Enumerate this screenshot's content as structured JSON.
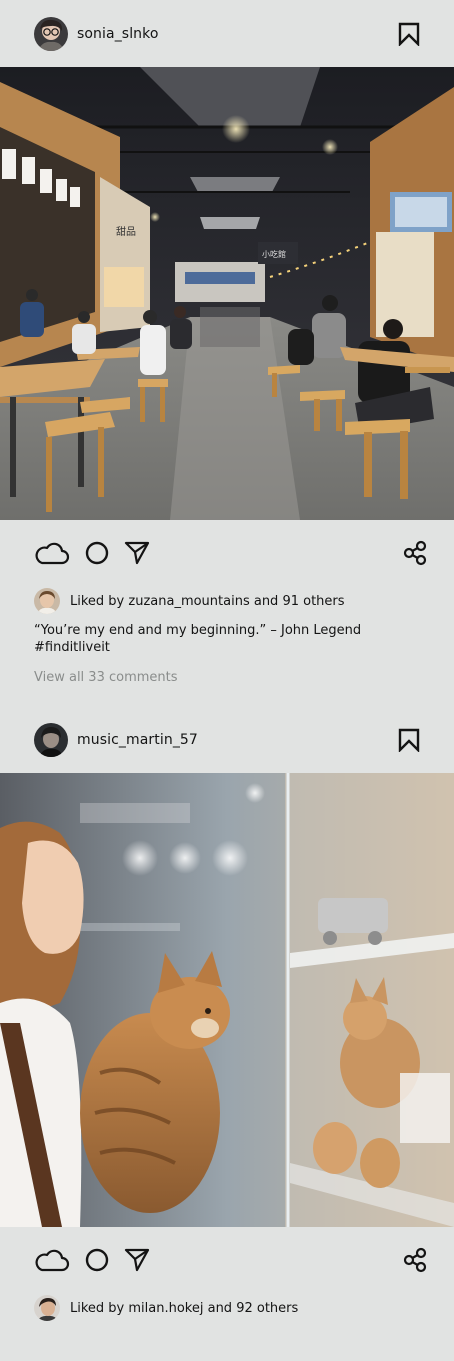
{
  "posts": [
    {
      "username": "sonia_slnko",
      "likes_text": "Liked by zuzana_mountains and 91 others",
      "caption_quote": "“You’re my end and my beginning.” – John Legend",
      "caption_tag": "#finditliveit",
      "comments_link": "View all 33 comments",
      "image_sign_text": "甜品",
      "image_sign2_text": "小吃館"
    },
    {
      "username": "music_martin_57",
      "likes_text": "Liked by milan.hokej and 92 others"
    }
  ],
  "icons": {
    "like": "cloud-icon",
    "comment": "circle-icon",
    "share_dm": "send-arrow-icon",
    "share": "share-nodes-icon",
    "save": "bookmark-icon"
  },
  "colors": {
    "background": "#e1e3e2",
    "text": "#141414",
    "muted": "#8a8d8c"
  }
}
